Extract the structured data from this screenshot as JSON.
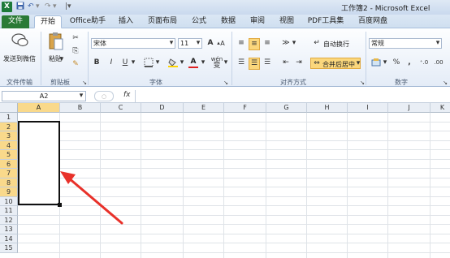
{
  "window": {
    "title": "工作簿2 - Microsoft Excel"
  },
  "quick_access": {
    "app_icon": "X",
    "save_icon": "save-icon",
    "undo_icon": "undo-icon",
    "redo_icon": "redo-icon",
    "customize_icon": "customize-icon"
  },
  "tabs": [
    {
      "label": "文件"
    },
    {
      "label": "开始"
    },
    {
      "label": "Office助手"
    },
    {
      "label": "插入"
    },
    {
      "label": "页面布局"
    },
    {
      "label": "公式"
    },
    {
      "label": "数据"
    },
    {
      "label": "审阅"
    },
    {
      "label": "视图"
    },
    {
      "label": "PDF工具集"
    },
    {
      "label": "百度网盘"
    }
  ],
  "ribbon": {
    "file_transfer": {
      "send_label": "发送到微信",
      "group": "文件传输"
    },
    "clipboard": {
      "paste_label": "粘贴",
      "group": "剪贴板"
    },
    "font": {
      "name": "宋体",
      "size": "11",
      "grow": "A",
      "shrink": "A",
      "bold": "B",
      "italic": "I",
      "underline": "U",
      "group": "字体",
      "wen": "wén"
    },
    "alignment": {
      "wrap_label": "自动换行",
      "merge_label": "合并后居中",
      "group": "对齐方式"
    },
    "number": {
      "format": "常规",
      "percent": "%",
      "comma": ",",
      "group": "数字"
    }
  },
  "formula_bar": {
    "name_box": "A2",
    "fx": "fx",
    "value": ""
  },
  "sheet": {
    "columns": [
      "A",
      "B",
      "C",
      "D",
      "E",
      "F",
      "G",
      "H",
      "I",
      "J",
      "K"
    ],
    "rows": [
      "1",
      "2",
      "3",
      "4",
      "5",
      "6",
      "7",
      "8",
      "9",
      "10",
      "11",
      "12",
      "13",
      "14",
      "15"
    ],
    "selected_range": "A2:A9"
  },
  "colors": {
    "file_tab": "#2a7a36",
    "selection_header": "#f9d98b",
    "arrow": "#e8312a"
  }
}
